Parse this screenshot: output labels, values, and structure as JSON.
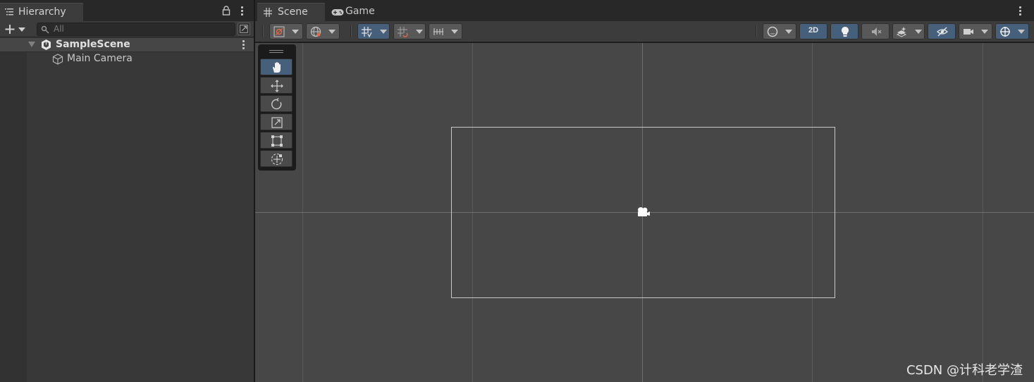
{
  "hierarchy": {
    "tab_label": "Hierarchy",
    "search_placeholder": "All",
    "scene_name": "SampleScene",
    "items": [
      {
        "label": "Main Camera"
      }
    ]
  },
  "scene_view": {
    "tabs": [
      {
        "label": "Scene",
        "icon": "grid-icon"
      },
      {
        "label": "Game",
        "icon": "gamepad-icon"
      }
    ],
    "toolbar": {
      "mode_2d_label": "2D"
    },
    "tools": [
      "view-tool",
      "move-tool",
      "rotate-tool",
      "scale-tool",
      "rect-tool",
      "transform-tool"
    ],
    "active_tool": "view-tool"
  },
  "colors": {
    "accent_active": "#46607c",
    "panel_bg": "#383838",
    "viewport_bg": "#474747"
  },
  "watermark": "CSDN @计科老学渣"
}
